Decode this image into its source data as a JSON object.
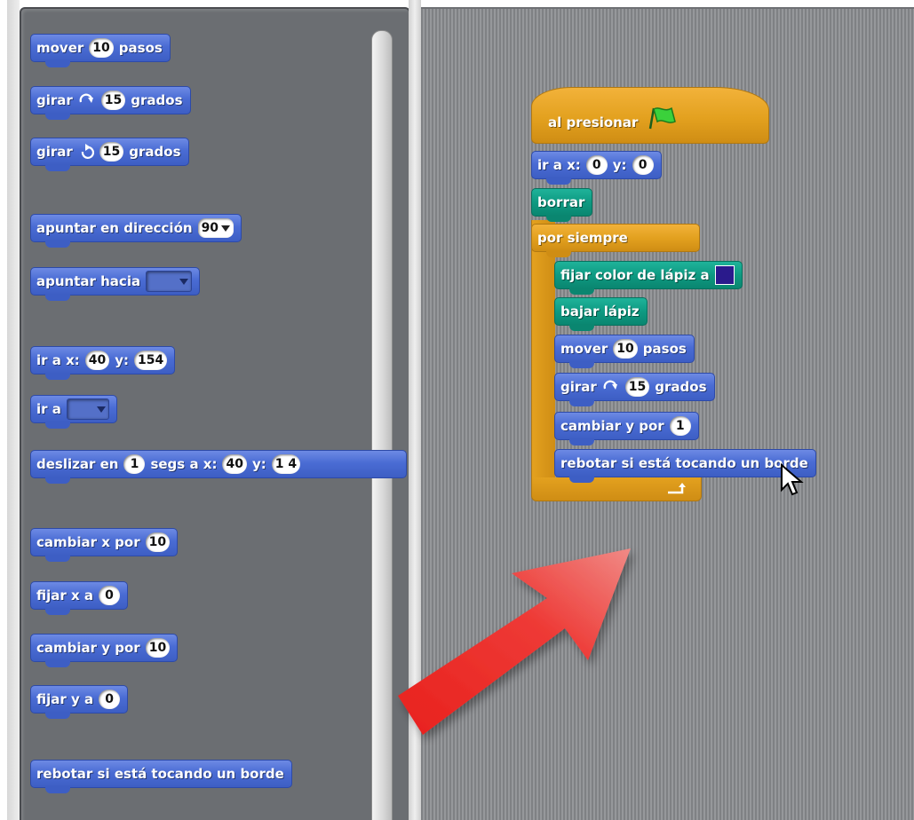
{
  "palette": {
    "blocks": [
      {
        "id": "move",
        "pre": "mover",
        "num": "10",
        "post": "pasos"
      },
      {
        "id": "turn-cw",
        "pre": "girar",
        "num": "15",
        "post": "grados",
        "icon": "rotate-clockwise-icon"
      },
      {
        "id": "turn-ccw",
        "pre": "girar",
        "num": "15",
        "post": "grados",
        "icon": "rotate-counterclockwise-icon"
      },
      {
        "id": "point-dir",
        "pre": "apuntar en dirección",
        "value": "90"
      },
      {
        "id": "point-towards",
        "pre": "apuntar hacia"
      },
      {
        "id": "goto-xy",
        "pre": "ir a x:",
        "x": "40",
        "ylabel": "y:",
        "y": "154"
      },
      {
        "id": "goto",
        "pre": "ir a"
      },
      {
        "id": "glide",
        "pre": "deslizar en",
        "secs": "1",
        "mid": "segs a x:",
        "x": "40",
        "ylabel": "y:",
        "y": "1 4"
      },
      {
        "id": "change-x",
        "pre": "cambiar x por",
        "num": "10"
      },
      {
        "id": "set-x",
        "pre": "fijar x a",
        "num": "0"
      },
      {
        "id": "change-y",
        "pre": "cambiar y por",
        "num": "10"
      },
      {
        "id": "set-y",
        "pre": "fijar y a",
        "num": "0"
      },
      {
        "id": "bounce",
        "pre": "rebotar si está tocando un borde"
      }
    ]
  },
  "script": {
    "hat": "al presionar",
    "goto": {
      "pre": "ir a x:",
      "x": "0",
      "ylabel": "y:",
      "y": "0"
    },
    "clear": "borrar",
    "forever": "por siempre",
    "set_pen_color": "fijar color de lápiz a",
    "pen_down": "bajar lápiz",
    "move": {
      "pre": "mover",
      "num": "10",
      "post": "pasos"
    },
    "turn": {
      "pre": "girar",
      "num": "15",
      "post": "grados"
    },
    "change_y": {
      "pre": "cambiar y por",
      "num": "1"
    },
    "bounce": "rebotar si está tocando un borde",
    "pen_color": "#2a1a8c"
  },
  "colors": {
    "motion": "#4a6cd4",
    "pen": "#0e9a82",
    "control": "#e3a11f",
    "arrow": "#e8211d"
  }
}
